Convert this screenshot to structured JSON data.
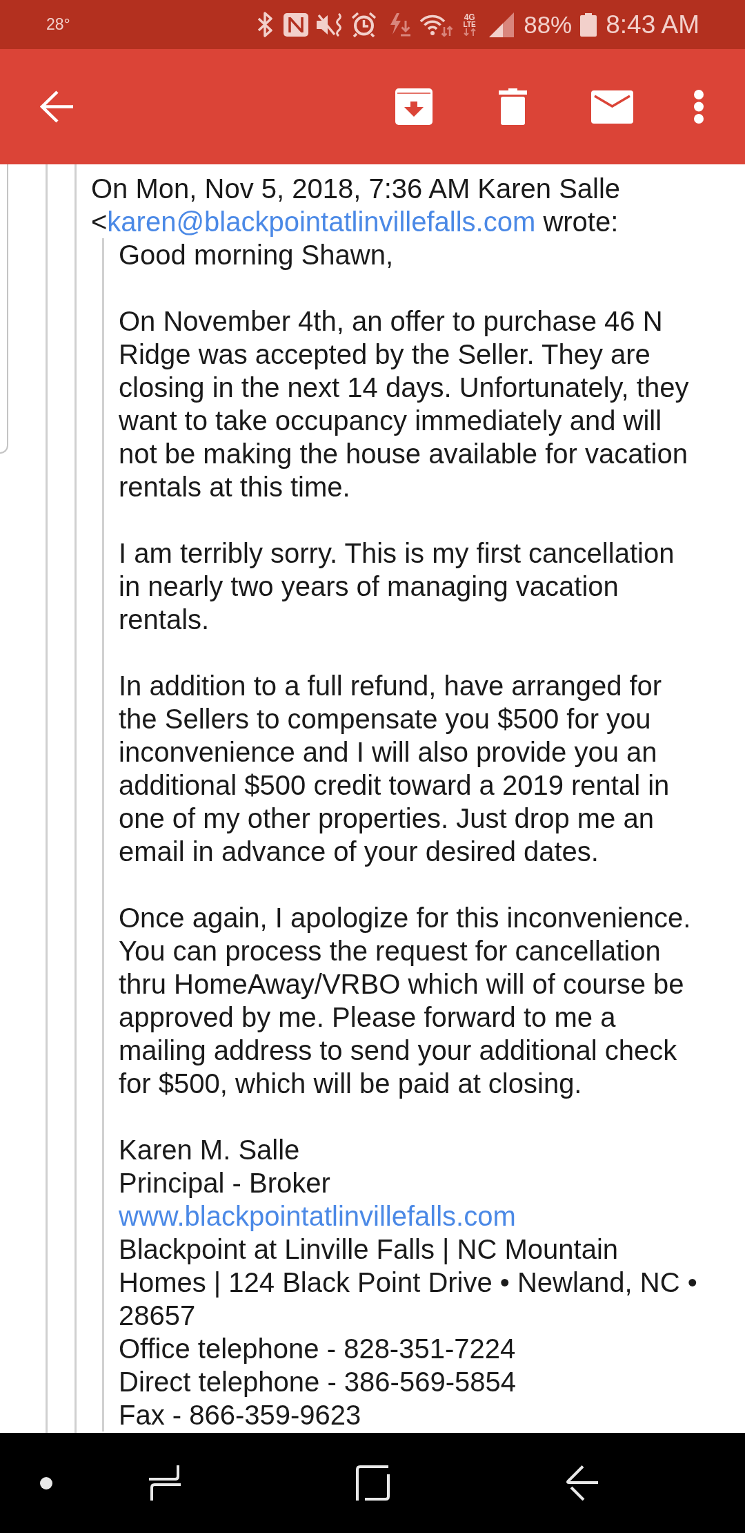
{
  "status_bar": {
    "temperature": "28°",
    "network": {
      "generation": "4G",
      "technology": "LTE"
    },
    "battery": "88%",
    "time": "8:43 AM"
  },
  "message": {
    "header": {
      "line_1": "On Mon, Nov 5, 2018, 7:36 AM Karen Salle",
      "open_bracket": "<",
      "email": "karen@blackpointatlinvillefalls.com",
      "suffix": "wrote:"
    },
    "greeting": "Good morning Shawn,",
    "paragraphs": [
      [
        "On November 4th, an offer to purchase 46 N",
        "Ridge was accepted by the Seller. They are",
        "closing in the next 14 days. Unfortunately, they",
        "want to take occupancy immediately and will",
        "not be making the house available for vacation",
        "rentals at this time."
      ],
      [
        "I am terribly sorry. This is my first cancellation",
        "in nearly two years of managing vacation",
        "rentals."
      ],
      [
        "In addition to a full refund, have arranged for",
        "the Sellers to compensate you $500 for you",
        "inconvenience and I will also provide you an",
        "additional $500 credit toward a 2019 rental in",
        "one of my other properties. Just drop me an",
        "email in advance of your desired dates."
      ],
      [
        "Once again, I apologize for this inconvenience.",
        "You can process the request for cancellation",
        "thru HomeAway/VRBO which will of course be",
        "approved by me. Please forward to me a",
        "mailing address to send your additional check",
        "for $500, which will be paid at closing."
      ]
    ],
    "signature": {
      "name": "Karen M. Salle",
      "title": "Principal - Broker",
      "website": "www.blackpointatlinvillefalls.com",
      "address_lines": [
        "Blackpoint at Linville Falls | NC Mountain",
        "Homes | 124 Black Point Drive • Newland, NC •",
        "28657"
      ],
      "contact_lines": [
        "Office telephone - 828-351-7224",
        "Direct telephone - 386-569-5854",
        "Fax - 866-359-9623"
      ]
    }
  }
}
